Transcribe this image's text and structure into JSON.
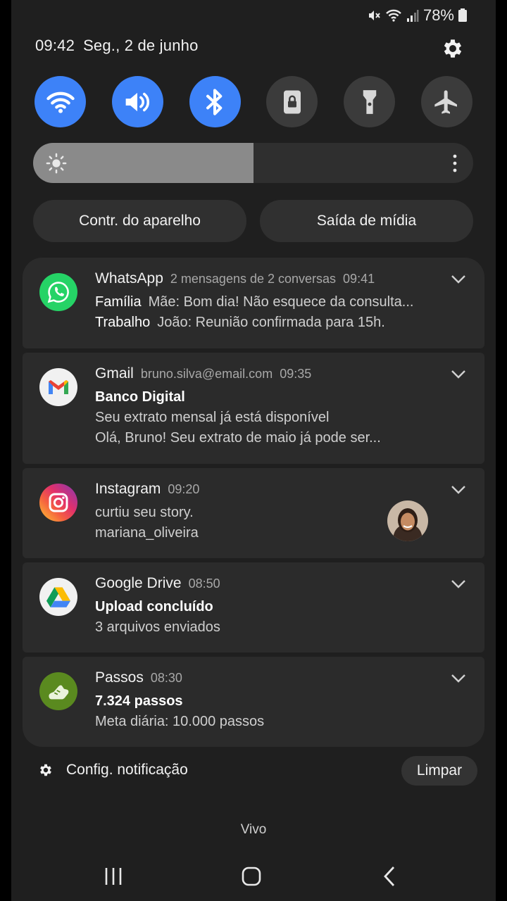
{
  "status_bar": {
    "battery": "78%"
  },
  "header": {
    "time": "09:42",
    "date": "Seg., 2 de junho"
  },
  "toggles": [
    {
      "name": "wifi",
      "icon": "wifi-icon",
      "state": "on"
    },
    {
      "name": "sound",
      "icon": "speaker-icon",
      "state": "on"
    },
    {
      "name": "bluetooth",
      "icon": "bluetooth-icon",
      "state": "on"
    },
    {
      "name": "portrait",
      "icon": "portrait-lock-icon",
      "state": "off"
    },
    {
      "name": "flashlight",
      "icon": "flashlight-icon",
      "state": "off"
    },
    {
      "name": "airplane",
      "icon": "airplane-icon",
      "state": "off"
    }
  ],
  "brightness": {
    "level": 0.5
  },
  "buttons": {
    "device_control": "Contr. do aparelho",
    "media_output": "Saída de mídia"
  },
  "notifications": {
    "whatsapp": {
      "app": "WhatsApp",
      "summary": "2 mensagens de 2 conversas",
      "time": "09:41",
      "messages": [
        {
          "sender": "Família",
          "text": "Mãe: Bom dia! Não esquece da consulta..."
        },
        {
          "sender": "Trabalho",
          "text": "João: Reunião confirmada para 15h."
        }
      ]
    },
    "gmail": {
      "app": "Gmail",
      "account": "bruno.silva@email.com",
      "time": "09:35",
      "title": "Banco Digital",
      "subject": "Seu extrato mensal já está disponível",
      "preview": "Olá, Bruno! Seu extrato de maio já pode ser..."
    },
    "instagram": {
      "app": "Instagram",
      "time": "09:20",
      "text": "curtiu seu story.",
      "user": "mariana_oliveira"
    },
    "drive": {
      "app": "Google Drive",
      "time": "08:50",
      "title": "Upload concluído",
      "text": "3 arquivos enviados"
    },
    "steps": {
      "app": "Passos",
      "time": "08:30",
      "title": "7.324 passos",
      "text": "Meta diária: 10.000 passos"
    }
  },
  "footer": {
    "settings_label": "Config. notificação",
    "clear_label": "Limpar"
  },
  "carrier": "Vivo",
  "colors": {
    "accent": "#3d82f8",
    "background": "#1f1f1f",
    "card": "#2b2b2b"
  }
}
